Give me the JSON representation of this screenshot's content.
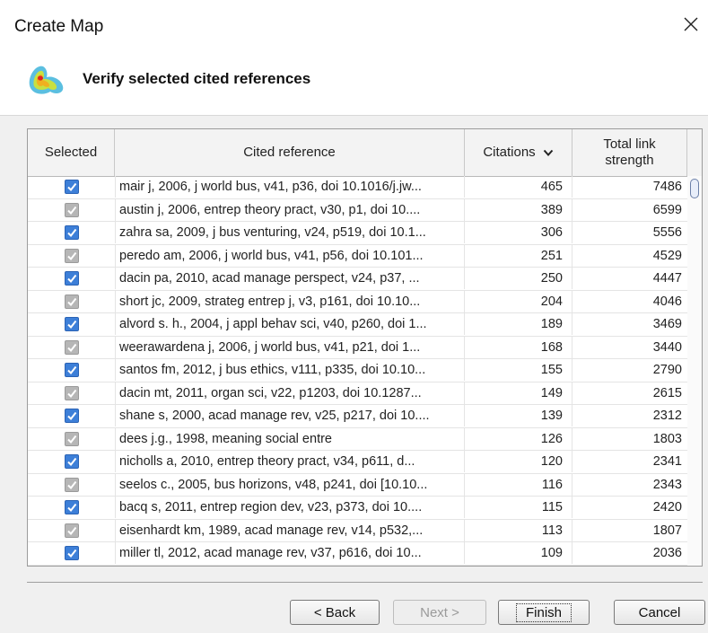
{
  "window": {
    "title": "Create Map",
    "close_icon": "close-icon"
  },
  "header": {
    "title": "Verify selected cited references",
    "icon": "vosviewer-density-icon"
  },
  "table": {
    "columns": [
      "Selected",
      "Cited reference",
      "Citations",
      "Total link\nstrength"
    ],
    "sort_icon": "chevron-down-icon",
    "rows": [
      {
        "selected": true,
        "reference": "mair j, 2006, j world bus, v41, p36, doi 10.1016/j.jw...",
        "citations": "465",
        "tls": "7486"
      },
      {
        "selected": true,
        "reference": "austin j, 2006, entrep theory pract, v30, p1, doi 10....",
        "citations": "389",
        "tls": "6599"
      },
      {
        "selected": true,
        "reference": "zahra sa, 2009, j bus venturing, v24, p519, doi 10.1...",
        "citations": "306",
        "tls": "5556"
      },
      {
        "selected": true,
        "reference": "peredo am, 2006, j world bus, v41, p56, doi 10.101...",
        "citations": "251",
        "tls": "4529"
      },
      {
        "selected": true,
        "reference": "dacin pa, 2010, acad manage perspect, v24, p37, ...",
        "citations": "250",
        "tls": "4447"
      },
      {
        "selected": true,
        "reference": "short jc, 2009, strateg entrep j, v3, p161, doi 10.10...",
        "citations": "204",
        "tls": "4046"
      },
      {
        "selected": true,
        "reference": "alvord s. h., 2004, j appl behav sci, v40, p260, doi 1...",
        "citations": "189",
        "tls": "3469"
      },
      {
        "selected": true,
        "reference": "weerawardena j, 2006, j world bus, v41, p21, doi 1...",
        "citations": "168",
        "tls": "3440"
      },
      {
        "selected": true,
        "reference": "santos fm, 2012, j bus ethics, v111, p335, doi 10.10...",
        "citations": "155",
        "tls": "2790"
      },
      {
        "selected": true,
        "reference": "dacin mt, 2011, organ sci, v22, p1203, doi 10.1287...",
        "citations": "149",
        "tls": "2615"
      },
      {
        "selected": true,
        "reference": "shane s, 2000, acad manage rev, v25, p217, doi 10....",
        "citations": "139",
        "tls": "2312"
      },
      {
        "selected": true,
        "reference": "dees j.g., 1998, meaning social entre",
        "citations": "126",
        "tls": "1803"
      },
      {
        "selected": true,
        "reference": "nicholls a, 2010, entrep theory pract, v34, p611, d...",
        "citations": "120",
        "tls": "2341"
      },
      {
        "selected": true,
        "reference": "seelos c., 2005, bus horizons, v48, p241, doi [10.10...",
        "citations": "116",
        "tls": "2343"
      },
      {
        "selected": true,
        "reference": "bacq s, 2011, entrep region dev, v23, p373, doi 10....",
        "citations": "115",
        "tls": "2420"
      },
      {
        "selected": true,
        "reference": "eisenhardt km, 1989, acad manage rev, v14, p532,...",
        "citations": "113",
        "tls": "1807"
      },
      {
        "selected": true,
        "reference": "miller tl, 2012, acad manage rev, v37, p616, doi 10...",
        "citations": "109",
        "tls": "2036"
      }
    ]
  },
  "buttons": {
    "back": "< Back",
    "next": "Next >",
    "finish": "Finish",
    "cancel": "Cancel"
  },
  "colors": {
    "checkbox_on": "#3d7fd8",
    "checkbox_dim": "#b6b6b6"
  }
}
